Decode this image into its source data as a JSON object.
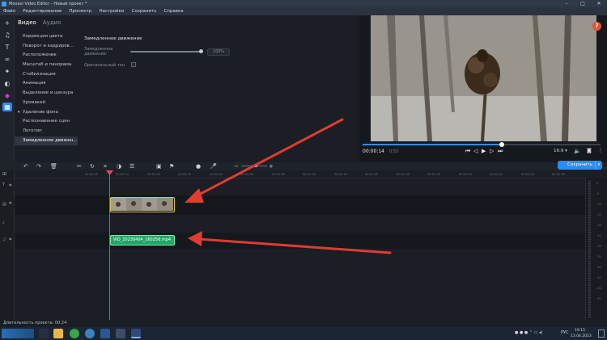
{
  "window": {
    "title": "Movavi Video Editor – Новый проект *"
  },
  "menu": [
    "Файл",
    "Редактирование",
    "Просмотр",
    "Настройки",
    "Сохранить",
    "Справка"
  ],
  "tabs": {
    "video": "Видео",
    "audio": "Аудио"
  },
  "properties": [
    "Коррекция цвета",
    "Поворот и кадриров...",
    "Расположение",
    "Масштаб и панорама",
    "Стабилизация",
    "Анимация",
    "Выделение и цензура",
    "Хромакей",
    "Удаление фона",
    "Распознавание сцен",
    "Логотип",
    "Замедленное движен..."
  ],
  "panel": {
    "title": "Замедленное движение",
    "speed_label": "Замедленное движение:",
    "speed_value": "100%",
    "pitch_label": "Оригинальный тон"
  },
  "player": {
    "timecode": "00:00:14",
    "total": "0:53",
    "aspect": "16:9 ▾",
    "help": "?"
  },
  "toolbar": {
    "save_label": "Сохранить"
  },
  "ruler": [
    "00:00:00",
    "00:00:10",
    "00:00:20",
    "00:00:30",
    "00:00:40",
    "00:00:50",
    "00:01:00",
    "00:01:10",
    "00:01:20",
    "00:01:30",
    "00:01:40",
    "00:01:50",
    "00:02:00",
    "00:02:10",
    "00:02:20",
    "00:02:30"
  ],
  "tracks": {
    "audio_clip_name": "VID_20230404_160256.mp4"
  },
  "meter_labels": [
    "0",
    "-5",
    "-10",
    "-15",
    "-20",
    "-25",
    "-30",
    "-35",
    "-40",
    "-45",
    "-50",
    "-55"
  ],
  "status": {
    "duration": "Длительность проекта: 00:24"
  },
  "tray": {
    "lang": "РУС",
    "time": "19:15",
    "date": "13.04.2023"
  },
  "colors": {
    "accent": "#2d8cf0",
    "clip_border": "#e8c33a",
    "audio_clip": "#1fa86a",
    "arrow": "#e03c31"
  }
}
